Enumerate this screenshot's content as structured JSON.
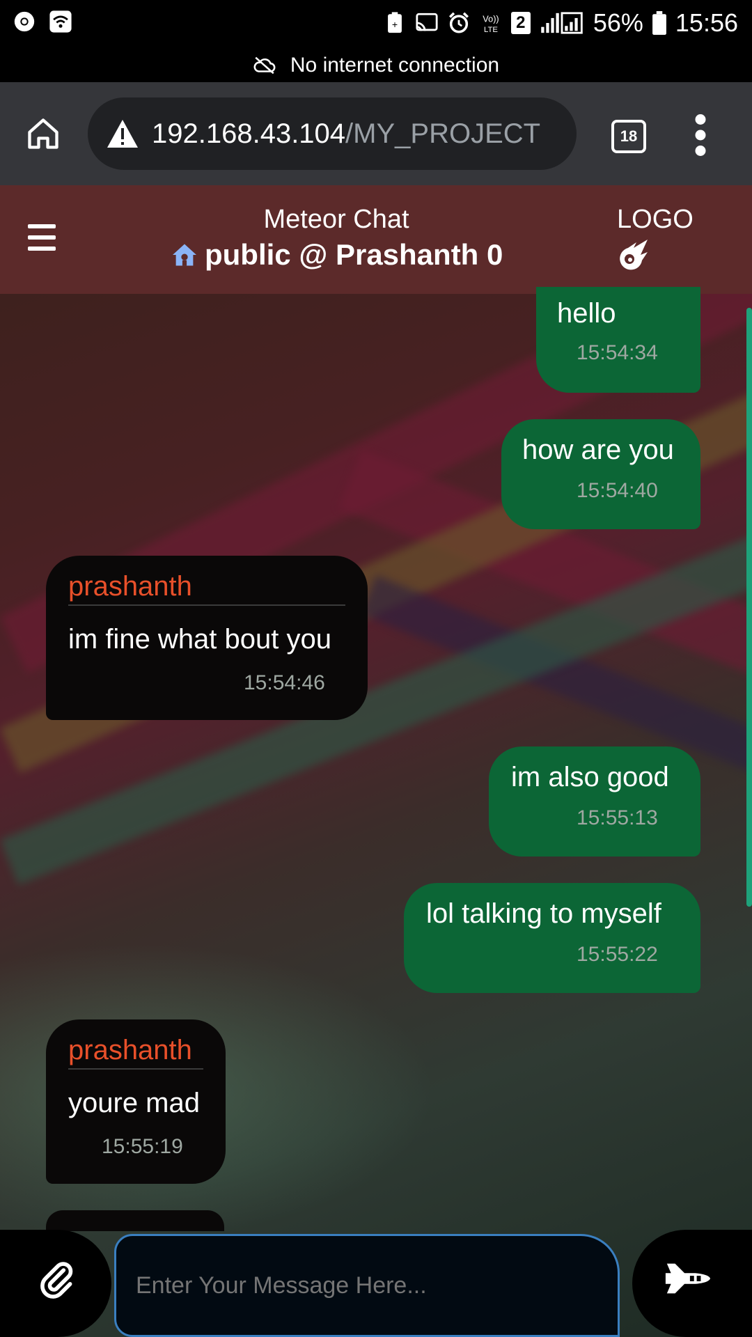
{
  "status_bar": {
    "battery": "56%",
    "time": "15:56",
    "sim_slot": "2"
  },
  "offline_banner": {
    "text": "No internet connection",
    "icon": "cloud-off-icon"
  },
  "browser": {
    "url_host": "192.168.43.104",
    "url_path": "/MY_PROJECT",
    "tab_count": "18",
    "icons": [
      "home-icon",
      "warning-icon",
      "more-vert-icon"
    ]
  },
  "app_header": {
    "title": "Meteor Chat",
    "room_line": "public @ Prashanth 0",
    "logo_label": "LOGO",
    "icons": [
      "menu-icon",
      "house-icon",
      "meteor-logo-icon"
    ]
  },
  "messages": [
    {
      "type": "sent",
      "text": "hello",
      "time": "15:54:34"
    },
    {
      "type": "sent",
      "text": "how are you",
      "time": "15:54:40"
    },
    {
      "type": "received",
      "sender": "prashanth",
      "text": "im fine what bout you",
      "time": "15:54:46"
    },
    {
      "type": "sent",
      "text": "im also good",
      "time": "15:55:13"
    },
    {
      "type": "sent",
      "text": "lol talking to myself",
      "time": "15:55:22"
    },
    {
      "type": "received",
      "sender": "prashanth",
      "text": "youre mad",
      "time": "15:55:19"
    }
  ],
  "composer": {
    "placeholder": "Enter Your Message Here...",
    "icons": [
      "paperclip-icon",
      "space-shuttle-icon"
    ]
  },
  "colors": {
    "header_bg": "#5c2a2a",
    "sent_bubble": "#0c6636",
    "received_bubble": "#0a0808",
    "sender_name": "#e8502a",
    "input_border": "#3a7fc0"
  }
}
